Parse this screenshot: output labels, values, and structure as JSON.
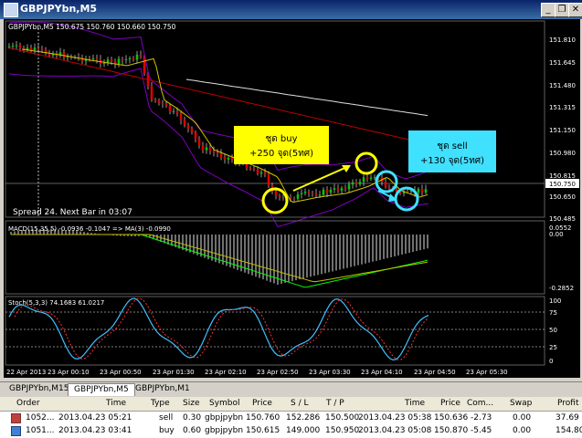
{
  "window": {
    "title": "GBPJPYbn,M5"
  },
  "chart": {
    "label": "GBPJPYbn,M5  150.675 150.760 150.660 150.750",
    "price_ticks": [
      "151.810",
      "151.645",
      "151.480",
      "151.315",
      "151.150",
      "150.980",
      "150.815",
      "150.650",
      "150.485"
    ],
    "current_price": "150.750",
    "spread_text": "Spread  24. Next Bar in 03:07",
    "time_ticks": [
      "22 Apr 2013",
      "23 Apr 00:10",
      "23 Apr 00:50",
      "23 Apr 01:30",
      "23 Apr 02:10",
      "23 Apr 02:50",
      "23 Apr 03:30",
      "23 Apr 04:10",
      "23 Apr 04:50",
      "23 Apr 05:30"
    ],
    "buy_box": {
      "line1": "ชุด buy",
      "line2": "+250 จุด(5ทศ)"
    },
    "sell_box": {
      "line1": "ชุด sell",
      "line2": "+130 จุด(5ทศ)"
    }
  },
  "macd": {
    "label": "MACD(15,35,5) -0.0936 -0.1047 => MA(3) -0.0990",
    "ticks": [
      "0.0552",
      "0.00",
      "-0.2852"
    ]
  },
  "stoch": {
    "label": "Stoch(5,3,3) 74.1683 61.0217",
    "ticks": [
      "100",
      "75",
      "50",
      "25",
      "0"
    ]
  },
  "tabs": [
    {
      "label": "GBPJPYbn,M15"
    },
    {
      "label": "GBPJPYbn,M5"
    },
    {
      "label": "GBPJPYbn,M1"
    }
  ],
  "orders": {
    "columns": [
      "Order",
      "Time",
      "Type",
      "Size",
      "Symbol",
      "Price",
      "S / L",
      "T / P",
      "Time",
      "Price",
      "Com...",
      "Swap",
      "Profit"
    ],
    "rows": [
      [
        "1052...",
        "2013.04.23 05:21",
        "sell",
        "0.30",
        "gbpjpybn",
        "150.760",
        "152.286",
        "150.500",
        "2013.04.23 05:38",
        "150.636",
        "-2.73",
        "0.00",
        "37.69"
      ],
      [
        "1051...",
        "2013.04.23 03:41",
        "buy",
        "0.60",
        "gbpjpybn",
        "150.615",
        "149.000",
        "150.950",
        "2013.04.23 05:08",
        "150.870",
        "-5.45",
        "0.00",
        "154.80"
      ]
    ]
  },
  "colors": {
    "bull": "#00c800",
    "bear": "#e00000",
    "bands": "#8000c0",
    "ma_slow": "#c00000",
    "ma_long": "#e0e0e0",
    "ma_fast": "#d4c400",
    "highlight_yellow": "#ffff00",
    "highlight_cyan": "#40e0ff"
  }
}
